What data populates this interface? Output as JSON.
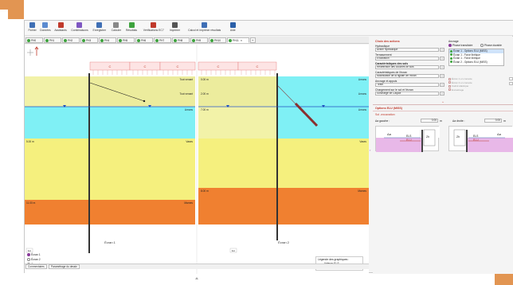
{
  "toolbar": {
    "items": [
      {
        "label": "Fichier",
        "icon": "file-icon",
        "color": "#3f6fb5"
      },
      {
        "label": "Données",
        "icon": "data-icon",
        "color": "#5b8bd0"
      },
      {
        "label": "Assistants",
        "icon": "wizard-icon",
        "color": "#c0392b"
      },
      {
        "label": "Combinaisons",
        "icon": "combinations-icon",
        "color": "#7e57c2"
      },
      {
        "label": "Enregistrer",
        "icon": "save-icon",
        "color": "#3f6fb5"
      },
      {
        "label": "Calculer",
        "icon": "calculate-icon",
        "color": "#888888"
      },
      {
        "label": "Résultats",
        "icon": "results-icon",
        "color": "#3da33d"
      },
      {
        "label": "Vérifications EC7",
        "icon": "verifications-icon",
        "color": "#c0392b"
      },
      {
        "label": "Imprimer",
        "icon": "print-icon",
        "color": "#555555"
      },
      {
        "label": "Calcul et imprimer résultats",
        "icon": "calc-print-icon",
        "color": "#3f6fb5"
      },
      {
        "label": "Aide",
        "icon": "help-icon",
        "color": "#2a5fa8"
      }
    ]
  },
  "tabs": [
    "PH0",
    "PH1",
    "PH2",
    "PH3",
    "PH4",
    "PH5",
    "PH6",
    "PH7",
    "PH8",
    "PH9",
    "PH10",
    "PH11"
  ],
  "active_tab": "PH11",
  "diagram": {
    "screen1": {
      "label": "Écran 1",
      "layers": [
        {
          "name": "Tout venant",
          "depth": "",
          "color": "#f2f2a8"
        },
        {
          "name": "Tout venant",
          "depth": "",
          "color": "#f2f2a8"
        },
        {
          "name": "Limons",
          "depth": "",
          "color": "#7ff0f5"
        },
        {
          "name": "Vases",
          "depth": "5.00 m",
          "color": "#f5f07e"
        },
        {
          "name": "Marnes",
          "depth": "11.00 m",
          "color": "#f08030"
        }
      ]
    },
    "screen2": {
      "label": "Écran 2",
      "layers": [
        {
          "name": "Limons",
          "depth": "0.00 m",
          "color": "#7ff0f5"
        },
        {
          "name": "Limons",
          "depth": "2.00 m",
          "color": "#7ff0f5"
        },
        {
          "name": "Limons",
          "depth": "7.00 m",
          "color": "#7ff0f5"
        },
        {
          "name": "Vases",
          "depth": "",
          "color": "#f5f07e"
        },
        {
          "name": "Marnes",
          "depth": "8.00 m",
          "color": "#f08030"
        }
      ]
    },
    "load_label": "C",
    "scale_label": "1m"
  },
  "left_options": [
    {
      "label": "Écran 1",
      "selected": true
    },
    {
      "label": "Écran 2",
      "selected": false
    },
    {
      "label": "Groupés",
      "selected": false
    }
  ],
  "legend": {
    "title": "Légende des graphiques :",
    "items": [
      "Valeurs ELS",
      "Valeurs ELU"
    ]
  },
  "bottom_tabs": [
    "Commentaires",
    "Paramétrage du dessin"
  ],
  "right": {
    "section1_title": "Choix des actions",
    "hydraulique_label": "Hydraulique",
    "hydraulique_value": "Action hydraulique",
    "terrassement_label": "Terrassement",
    "terrassement_value": "Excavation",
    "soil_label": "Caractéristiques des sols",
    "soil_value": "Redéfinition des couches de sols",
    "ecran_label": "Caractéristiques de l'écran",
    "ecran_value": "Modification de la rigidité de l'écran",
    "appuis_label": "Ancrage et appuis",
    "appuis_value": "Tirant",
    "surcharge_label": "Chargement sur le sol et l'écran",
    "surcharge_value": "Surcharge de Caquot",
    "ancrage_title": "Ancrage",
    "phase_transitoire": "Phase transitoire",
    "phase_durable": "Phase durable",
    "ancrage_list": [
      {
        "label": "Écran 1 - Options ELU (MISS)",
        "selected": true
      },
      {
        "label": "Écran 1 - Force linéique",
        "selected": false
      },
      {
        "label": "Écran 1 - Force linéique",
        "selected": false
      },
      {
        "label": "Écran 2 - Options ELU (MISS)",
        "selected": false
      }
    ],
    "checkboxes": [
      "Écran 1 en console",
      "Écran 2 en console",
      "Calcul élastique",
      "Encastrage"
    ],
    "section2_title": "Options ELU (MISS)",
    "subsection_title": "Sol -excavation",
    "gauche_label": "Δa gauche :",
    "gauche_value": "0.00",
    "gauche_unit": "m",
    "droite_label": "Δa droite :",
    "droite_value": "0.00",
    "droite_unit": "m",
    "scheme_left": {
      "delta": "Δa",
      "els": "ELS",
      "elu": "ELU",
      "zh": "Zh"
    },
    "scheme_right": {
      "delta": "Δa",
      "els": "ELS",
      "elu": "ELU",
      "zh": "Zh"
    },
    "btn_label": "..."
  }
}
